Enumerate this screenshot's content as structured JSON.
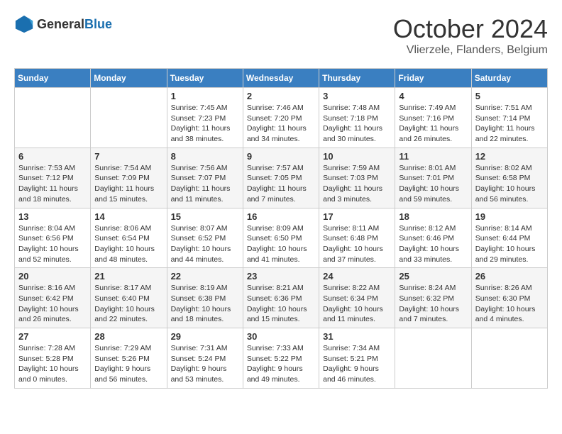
{
  "header": {
    "logo_general": "General",
    "logo_blue": "Blue",
    "month_title": "October 2024",
    "location": "Vlierzele, Flanders, Belgium"
  },
  "weekdays": [
    "Sunday",
    "Monday",
    "Tuesday",
    "Wednesday",
    "Thursday",
    "Friday",
    "Saturday"
  ],
  "weeks": [
    [
      {
        "day": "",
        "sunrise": "",
        "sunset": "",
        "daylight": ""
      },
      {
        "day": "",
        "sunrise": "",
        "sunset": "",
        "daylight": ""
      },
      {
        "day": "1",
        "sunrise": "Sunrise: 7:45 AM",
        "sunset": "Sunset: 7:23 PM",
        "daylight": "Daylight: 11 hours and 38 minutes."
      },
      {
        "day": "2",
        "sunrise": "Sunrise: 7:46 AM",
        "sunset": "Sunset: 7:20 PM",
        "daylight": "Daylight: 11 hours and 34 minutes."
      },
      {
        "day": "3",
        "sunrise": "Sunrise: 7:48 AM",
        "sunset": "Sunset: 7:18 PM",
        "daylight": "Daylight: 11 hours and 30 minutes."
      },
      {
        "day": "4",
        "sunrise": "Sunrise: 7:49 AM",
        "sunset": "Sunset: 7:16 PM",
        "daylight": "Daylight: 11 hours and 26 minutes."
      },
      {
        "day": "5",
        "sunrise": "Sunrise: 7:51 AM",
        "sunset": "Sunset: 7:14 PM",
        "daylight": "Daylight: 11 hours and 22 minutes."
      }
    ],
    [
      {
        "day": "6",
        "sunrise": "Sunrise: 7:53 AM",
        "sunset": "Sunset: 7:12 PM",
        "daylight": "Daylight: 11 hours and 18 minutes."
      },
      {
        "day": "7",
        "sunrise": "Sunrise: 7:54 AM",
        "sunset": "Sunset: 7:09 PM",
        "daylight": "Daylight: 11 hours and 15 minutes."
      },
      {
        "day": "8",
        "sunrise": "Sunrise: 7:56 AM",
        "sunset": "Sunset: 7:07 PM",
        "daylight": "Daylight: 11 hours and 11 minutes."
      },
      {
        "day": "9",
        "sunrise": "Sunrise: 7:57 AM",
        "sunset": "Sunset: 7:05 PM",
        "daylight": "Daylight: 11 hours and 7 minutes."
      },
      {
        "day": "10",
        "sunrise": "Sunrise: 7:59 AM",
        "sunset": "Sunset: 7:03 PM",
        "daylight": "Daylight: 11 hours and 3 minutes."
      },
      {
        "day": "11",
        "sunrise": "Sunrise: 8:01 AM",
        "sunset": "Sunset: 7:01 PM",
        "daylight": "Daylight: 10 hours and 59 minutes."
      },
      {
        "day": "12",
        "sunrise": "Sunrise: 8:02 AM",
        "sunset": "Sunset: 6:58 PM",
        "daylight": "Daylight: 10 hours and 56 minutes."
      }
    ],
    [
      {
        "day": "13",
        "sunrise": "Sunrise: 8:04 AM",
        "sunset": "Sunset: 6:56 PM",
        "daylight": "Daylight: 10 hours and 52 minutes."
      },
      {
        "day": "14",
        "sunrise": "Sunrise: 8:06 AM",
        "sunset": "Sunset: 6:54 PM",
        "daylight": "Daylight: 10 hours and 48 minutes."
      },
      {
        "day": "15",
        "sunrise": "Sunrise: 8:07 AM",
        "sunset": "Sunset: 6:52 PM",
        "daylight": "Daylight: 10 hours and 44 minutes."
      },
      {
        "day": "16",
        "sunrise": "Sunrise: 8:09 AM",
        "sunset": "Sunset: 6:50 PM",
        "daylight": "Daylight: 10 hours and 41 minutes."
      },
      {
        "day": "17",
        "sunrise": "Sunrise: 8:11 AM",
        "sunset": "Sunset: 6:48 PM",
        "daylight": "Daylight: 10 hours and 37 minutes."
      },
      {
        "day": "18",
        "sunrise": "Sunrise: 8:12 AM",
        "sunset": "Sunset: 6:46 PM",
        "daylight": "Daylight: 10 hours and 33 minutes."
      },
      {
        "day": "19",
        "sunrise": "Sunrise: 8:14 AM",
        "sunset": "Sunset: 6:44 PM",
        "daylight": "Daylight: 10 hours and 29 minutes."
      }
    ],
    [
      {
        "day": "20",
        "sunrise": "Sunrise: 8:16 AM",
        "sunset": "Sunset: 6:42 PM",
        "daylight": "Daylight: 10 hours and 26 minutes."
      },
      {
        "day": "21",
        "sunrise": "Sunrise: 8:17 AM",
        "sunset": "Sunset: 6:40 PM",
        "daylight": "Daylight: 10 hours and 22 minutes."
      },
      {
        "day": "22",
        "sunrise": "Sunrise: 8:19 AM",
        "sunset": "Sunset: 6:38 PM",
        "daylight": "Daylight: 10 hours and 18 minutes."
      },
      {
        "day": "23",
        "sunrise": "Sunrise: 8:21 AM",
        "sunset": "Sunset: 6:36 PM",
        "daylight": "Daylight: 10 hours and 15 minutes."
      },
      {
        "day": "24",
        "sunrise": "Sunrise: 8:22 AM",
        "sunset": "Sunset: 6:34 PM",
        "daylight": "Daylight: 10 hours and 11 minutes."
      },
      {
        "day": "25",
        "sunrise": "Sunrise: 8:24 AM",
        "sunset": "Sunset: 6:32 PM",
        "daylight": "Daylight: 10 hours and 7 minutes."
      },
      {
        "day": "26",
        "sunrise": "Sunrise: 8:26 AM",
        "sunset": "Sunset: 6:30 PM",
        "daylight": "Daylight: 10 hours and 4 minutes."
      }
    ],
    [
      {
        "day": "27",
        "sunrise": "Sunrise: 7:28 AM",
        "sunset": "Sunset: 5:28 PM",
        "daylight": "Daylight: 10 hours and 0 minutes."
      },
      {
        "day": "28",
        "sunrise": "Sunrise: 7:29 AM",
        "sunset": "Sunset: 5:26 PM",
        "daylight": "Daylight: 9 hours and 56 minutes."
      },
      {
        "day": "29",
        "sunrise": "Sunrise: 7:31 AM",
        "sunset": "Sunset: 5:24 PM",
        "daylight": "Daylight: 9 hours and 53 minutes."
      },
      {
        "day": "30",
        "sunrise": "Sunrise: 7:33 AM",
        "sunset": "Sunset: 5:22 PM",
        "daylight": "Daylight: 9 hours and 49 minutes."
      },
      {
        "day": "31",
        "sunrise": "Sunrise: 7:34 AM",
        "sunset": "Sunset: 5:21 PM",
        "daylight": "Daylight: 9 hours and 46 minutes."
      },
      {
        "day": "",
        "sunrise": "",
        "sunset": "",
        "daylight": ""
      },
      {
        "day": "",
        "sunrise": "",
        "sunset": "",
        "daylight": ""
      }
    ]
  ]
}
